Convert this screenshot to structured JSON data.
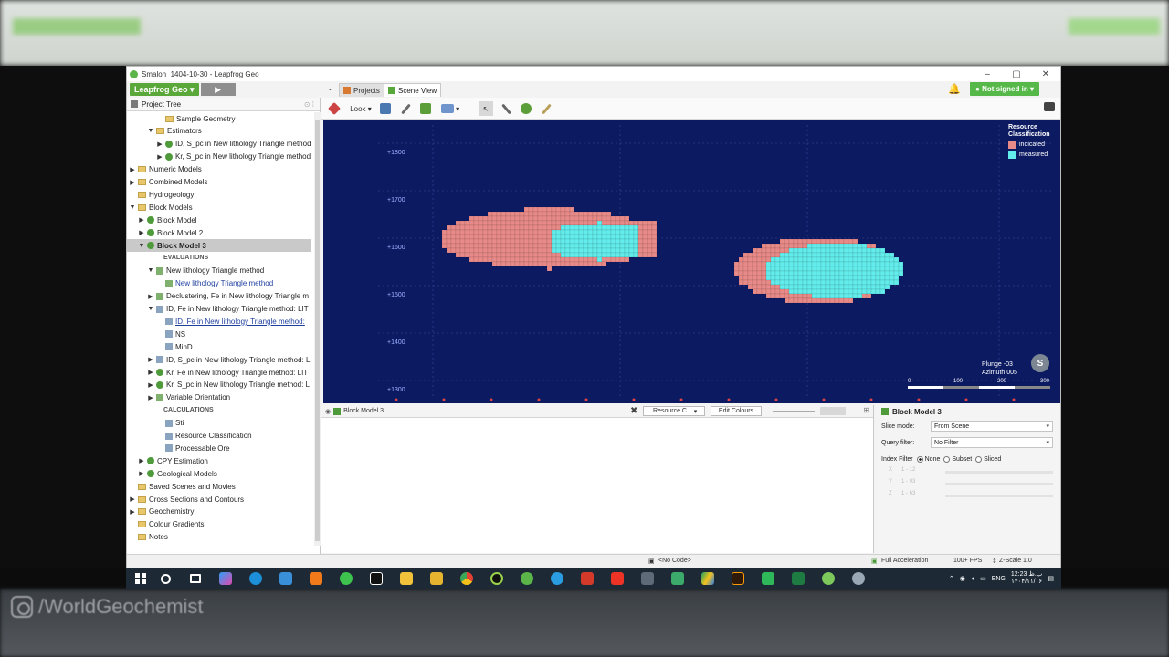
{
  "window": {
    "title": "Smalon_1404-10-30 - Leapfrog Geo",
    "brand": "Leapfrog Geo",
    "tabs": {
      "projects": "Projects",
      "scene": "Scene View"
    },
    "sign_in": "Not signed in"
  },
  "watermark": "/WorldGeochemist",
  "project_tree": {
    "title": "Project Tree",
    "rows": [
      {
        "label": "Sample Geometry",
        "indent": 3,
        "icon": "folder",
        "arrow": ""
      },
      {
        "label": "Estimators",
        "indent": 2,
        "icon": "folder",
        "arrow": "▼"
      },
      {
        "label": "ID, S_pc in New lithology Triangle method",
        "indent": 3,
        "icon": "estimator",
        "arrow": "▶"
      },
      {
        "label": "Kr, S_pc in New lithology Triangle method",
        "indent": 3,
        "icon": "estimator",
        "arrow": "▶"
      },
      {
        "label": "Numeric Models",
        "indent": 0,
        "icon": "folder",
        "arrow": "▶"
      },
      {
        "label": "Combined Models",
        "indent": 0,
        "icon": "folder",
        "arrow": "▶"
      },
      {
        "label": "Hydrogeology",
        "indent": 0,
        "icon": "folder",
        "arrow": ""
      },
      {
        "label": "Block Models",
        "indent": 0,
        "icon": "folder",
        "arrow": "▼"
      },
      {
        "label": "Block Model",
        "indent": 1,
        "icon": "block",
        "arrow": "▶"
      },
      {
        "label": "Block Model 2",
        "indent": 1,
        "icon": "block",
        "arrow": "▶"
      },
      {
        "label": "Block Model 3",
        "indent": 1,
        "icon": "block",
        "arrow": "▼",
        "selected": true
      },
      {
        "label": "EVALUATIONS",
        "indent": 3,
        "icon": "",
        "arrow": "",
        "header": true
      },
      {
        "label": "New lithology Triangle method",
        "indent": 2,
        "icon": "eval",
        "arrow": "▼"
      },
      {
        "label": "New lithology Triangle method",
        "indent": 3,
        "icon": "eval",
        "arrow": "",
        "link": true
      },
      {
        "label": "Declustering, Fe in New lithology Triangle m",
        "indent": 2,
        "icon": "eval",
        "arrow": "▶"
      },
      {
        "label": "ID, Fe in New lithology Triangle method: LIT",
        "indent": 2,
        "icon": "calc",
        "arrow": "▼"
      },
      {
        "label": "ID, Fe in New lithology Triangle method:",
        "indent": 3,
        "icon": "calc",
        "arrow": "",
        "link": true
      },
      {
        "label": "NS",
        "indent": 3,
        "icon": "calc",
        "arrow": ""
      },
      {
        "label": "MinD",
        "indent": 3,
        "icon": "calc",
        "arrow": ""
      },
      {
        "label": "ID, S_pc in New lithology Triangle method: L",
        "indent": 2,
        "icon": "calc",
        "arrow": "▶"
      },
      {
        "label": "Kr, Fe in New lithology Triangle method: LIT",
        "indent": 2,
        "icon": "estimator",
        "arrow": "▶"
      },
      {
        "label": "Kr, S_pc in New lithology Triangle method: L",
        "indent": 2,
        "icon": "estimator",
        "arrow": "▶"
      },
      {
        "label": "Variable Orientation",
        "indent": 2,
        "icon": "eval",
        "arrow": "▶"
      },
      {
        "label": "CALCULATIONS",
        "indent": 3,
        "icon": "",
        "arrow": "",
        "header": true
      },
      {
        "label": "Sti",
        "indent": 3,
        "icon": "calc",
        "arrow": ""
      },
      {
        "label": "Resource Classification",
        "indent": 3,
        "icon": "calc",
        "arrow": ""
      },
      {
        "label": "Processable Ore",
        "indent": 3,
        "icon": "calc",
        "arrow": ""
      },
      {
        "label": "CPY Estimation",
        "indent": 1,
        "icon": "block",
        "arrow": "▶"
      },
      {
        "label": "Geological Models",
        "indent": 1,
        "icon": "block",
        "arrow": "▶"
      },
      {
        "label": "Saved Scenes and Movies",
        "indent": 0,
        "icon": "folder",
        "arrow": ""
      },
      {
        "label": "Cross Sections and Contours",
        "indent": 0,
        "icon": "folder",
        "arrow": "▶"
      },
      {
        "label": "Geochemistry",
        "indent": 0,
        "icon": "folder",
        "arrow": "▶"
      },
      {
        "label": "Colour Gradients",
        "indent": 0,
        "icon": "folder",
        "arrow": ""
      },
      {
        "label": "Notes",
        "indent": 0,
        "icon": "folder",
        "arrow": ""
      }
    ]
  },
  "toolbar": {
    "look": "Look"
  },
  "viewport": {
    "elevations": [
      "+1800",
      "+1700",
      "+1600",
      "+1500",
      "+1400",
      "+1300"
    ],
    "legend": {
      "title": "Resource Classification",
      "items": [
        {
          "label": "indicated",
          "color": "#e88a88"
        },
        {
          "label": "measured",
          "color": "#62ecec"
        }
      ]
    },
    "plunge": "Plunge -03",
    "azimuth": "Azimuth 005",
    "scale": [
      "0",
      "100",
      "200",
      "300"
    ],
    "background": "#0c1a62"
  },
  "bottom_pane": {
    "title": "Block Model 3",
    "resource_select": "Resource C...",
    "edit_colours": "Edit Colours"
  },
  "properties": {
    "title": "Block Model 3",
    "slice_mode_label": "Slice mode:",
    "slice_mode_value": "From Scene",
    "query_filter_label": "Query filter:",
    "query_filter_value": "No Filter",
    "index_filter_label": "Index Filter",
    "index_options": [
      "None",
      "Subset",
      "Sliced"
    ],
    "dims": [
      {
        "axis": "X",
        "range": "1 - 12"
      },
      {
        "axis": "Y",
        "range": "1 - 93"
      },
      {
        "axis": "Z",
        "range": "1 - 63"
      }
    ]
  },
  "status": {
    "code": "<No Code>",
    "accel": "Full Acceleration",
    "fps": "100+ FPS",
    "zscale": "Z-Scale 1.0"
  },
  "taskbar": {
    "lang": "ENG",
    "time": "12:23 ب.ظ",
    "date": "۱۴۰۴/۱۱/۰۶"
  }
}
